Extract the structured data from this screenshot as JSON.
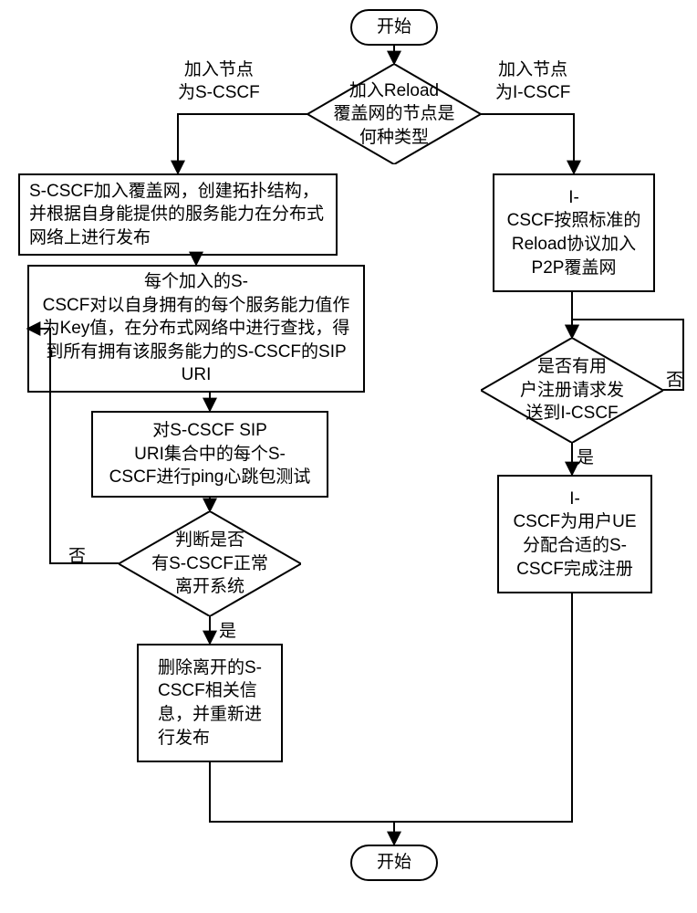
{
  "title": "S-CSCF / I-CSCF Reload 覆盖网节点加入流程图",
  "terminals": {
    "start": "开始",
    "end": "开始"
  },
  "decisions": {
    "node_type": "加入Reload\n覆盖网的节点是\n何种类型",
    "scscf_leave": "判断是否\n有S-CSCF正常\n离开系统",
    "user_register": "是否有用\n户注册请求发\n送到I-CSCF"
  },
  "branches": {
    "left": "加入节点\n为S-CSCF",
    "right": "加入节点\n为I-CSCF",
    "yes": "是",
    "no": "否"
  },
  "left": {
    "s1": "S-CSCF加入覆盖网，创建拓扑结构，并根据自身能提供的服务能力在分布式网络上进行发布",
    "s2": "每个加入的S-\nCSCF对以自身拥有的每个服务能力值作为Key值，在分布式网络中进行查找，得到所有拥有该服务能力的S-CSCF的SIP URI",
    "s3": "对S-CSCF SIP\nURI集合中的每个S-\nCSCF进行ping心跳包测试",
    "s4": "删除离开的S-\nCSCF相关信\n息，并重新进\n行发布"
  },
  "right": {
    "r1": "I-\nCSCF按照标准的\nReload协议加入\nP2P覆盖网",
    "r2": "I-\nCSCF为用户UE\n分配合适的S-\nCSCF完成注册"
  },
  "chart_data": {
    "type": "flowchart",
    "nodes": [
      {
        "id": "start",
        "type": "terminal",
        "text": "开始"
      },
      {
        "id": "d_type",
        "type": "decision",
        "text": "加入Reload覆盖网的节点是何种类型"
      },
      {
        "id": "s1",
        "type": "process",
        "text": "S-CSCF加入覆盖网，创建拓扑结构，并根据自身能提供的服务能力在分布式网络上进行发布"
      },
      {
        "id": "s2",
        "type": "process",
        "text": "每个加入的S-CSCF对以自身拥有的每个服务能力值作为Key值，在分布式网络中进行查找，得到所有拥有该服务能力的S-CSCF的SIP URI"
      },
      {
        "id": "s3",
        "type": "process",
        "text": "对S-CSCF SIP URI集合中的每个S-CSCF进行ping心跳包测试"
      },
      {
        "id": "d_leave",
        "type": "decision",
        "text": "判断是否有S-CSCF正常离开系统"
      },
      {
        "id": "s4",
        "type": "process",
        "text": "删除离开的S-CSCF相关信息，并重新进行发布"
      },
      {
        "id": "r1",
        "type": "process",
        "text": "I-CSCF按照标准的Reload协议加入P2P覆盖网"
      },
      {
        "id": "d_reg",
        "type": "decision",
        "text": "是否有用户注册请求发送到I-CSCF"
      },
      {
        "id": "r2",
        "type": "process",
        "text": "I-CSCF为用户UE分配合适的S-CSCF完成注册"
      },
      {
        "id": "end",
        "type": "terminal",
        "text": "开始"
      }
    ],
    "edges": [
      {
        "from": "start",
        "to": "d_type"
      },
      {
        "from": "d_type",
        "to": "s1",
        "label": "加入节点为S-CSCF"
      },
      {
        "from": "d_type",
        "to": "r1",
        "label": "加入节点为I-CSCF"
      },
      {
        "from": "s1",
        "to": "s2"
      },
      {
        "from": "s2",
        "to": "s3"
      },
      {
        "from": "s3",
        "to": "d_leave"
      },
      {
        "from": "d_leave",
        "to": "s4",
        "label": "是"
      },
      {
        "from": "d_leave",
        "to": "s2",
        "label": "否"
      },
      {
        "from": "s4",
        "to": "end"
      },
      {
        "from": "r1",
        "to": "d_reg"
      },
      {
        "from": "d_reg",
        "to": "r2",
        "label": "是"
      },
      {
        "from": "d_reg",
        "to": "d_reg",
        "label": "否"
      },
      {
        "from": "r2",
        "to": "end"
      }
    ]
  }
}
